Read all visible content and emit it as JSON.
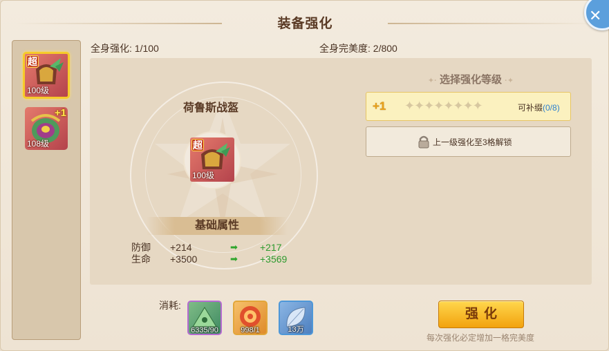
{
  "title": "装备强化",
  "stats": {
    "full_enhance_label": "全身强化:",
    "full_enhance_value": "1/100",
    "perfection_label": "全身完美度:",
    "perfection_value": "2/800"
  },
  "equipment_list": [
    {
      "badge": "超",
      "level": "100级",
      "selected": true
    },
    {
      "badge": "+1",
      "level": "108级",
      "selected": false
    }
  ],
  "item": {
    "name": "荷鲁斯战盔",
    "badge": "超",
    "level": "100级"
  },
  "base_attrs": {
    "title": "基础属性",
    "rows": [
      {
        "name": "防御",
        "current": "+214",
        "next": "+217"
      },
      {
        "name": "生命",
        "current": "+3500",
        "next": "+3569"
      }
    ]
  },
  "enhance_select": {
    "title": "选择强化等级",
    "option1": {
      "level": "+1",
      "star_count": 8,
      "tag": "可补缀",
      "tag_count": "(0/8)"
    },
    "option2": {
      "text": "上一级强化至3格解锁"
    }
  },
  "consume": {
    "label": "消耗:",
    "materials": [
      {
        "icon": "green-pyramid-gem",
        "count": "6335/90",
        "frame": "#b56ad1"
      },
      {
        "icon": "red-swirl-orb",
        "count": "998/1",
        "frame": "#e2a63a"
      },
      {
        "icon": "blue-leaf-crystal",
        "count": "13万",
        "frame": "#4d97d8"
      }
    ]
  },
  "enhance_button": "强化",
  "hint": "每次强化必定增加一格完美度",
  "colors": {
    "accent_gold": "#f2a20e",
    "attr_green": "#2d9a2e",
    "tag_blue": "#2a7fcf"
  }
}
